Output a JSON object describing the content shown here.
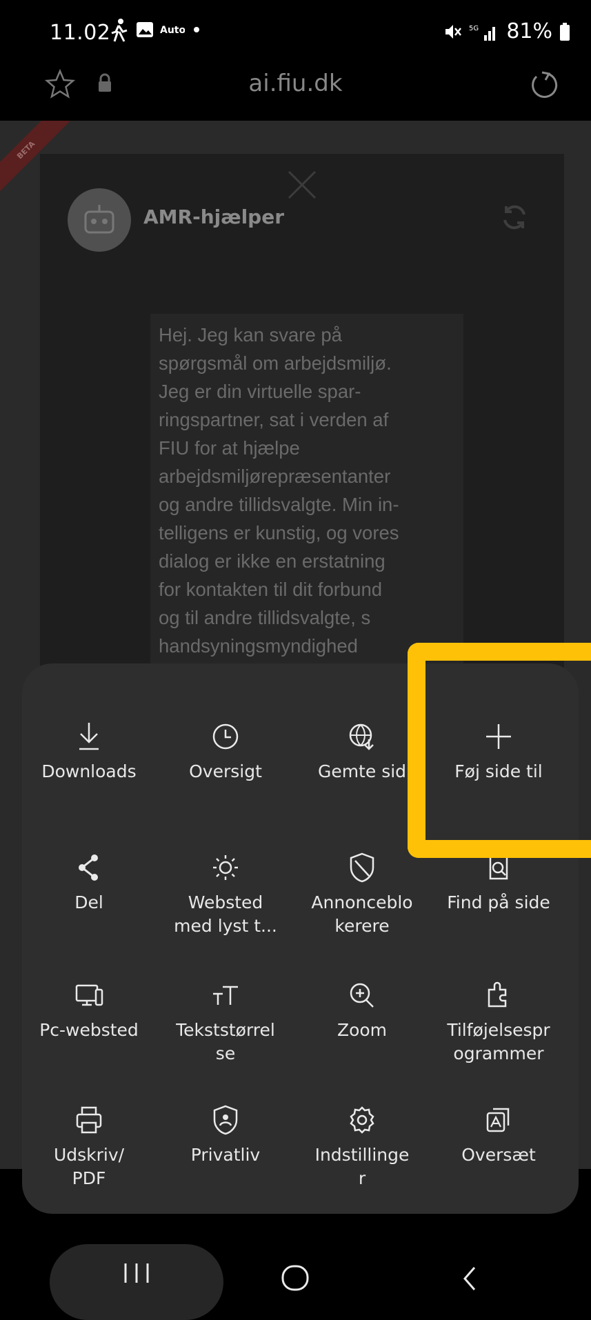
{
  "status_bar": {
    "time": "11.02",
    "battery": "81%",
    "icons": [
      "walk-icon",
      "image-icon",
      "auto-icon",
      "dot-icon",
      "mute-icon",
      "signal-icon",
      "battery-icon"
    ]
  },
  "url_bar": {
    "url": "ai.fiu.dk",
    "icons": [
      "star-icon",
      "lock-icon",
      "reload-icon"
    ]
  },
  "page": {
    "beta": "BETA",
    "bot_name": "AMR-hjælper",
    "message": "Hej. Jeg kan svare på\nspørgsmål om arbejdsmiljø.\nJeg er din virtuelle spar-\nringspartner, sat i verden af\nFIU for at hjælpe\narbejdsmiljørepræsentanter\nog andre tillidsvalgte. Min in-\ntelligens er kunstig, og vores\ndialog er ikke en erstatning\nfor kontakten til dit forbund\nog til andre tillidsvalgte, s\nhandsyningsmyndighed"
  },
  "menu": {
    "items": [
      {
        "label": "Downloads",
        "icon": "download-icon"
      },
      {
        "label": "Oversigt",
        "icon": "clock-icon"
      },
      {
        "label": "Gemte sid",
        "icon": "saved-pages-icon"
      },
      {
        "label": "Føj side til",
        "icon": "plus-icon"
      },
      {
        "label": "Del",
        "icon": "share-icon"
      },
      {
        "label": "Websted\nmed lyst t...",
        "icon": "sun-icon"
      },
      {
        "label": "Annonceblo\nkerere",
        "icon": "ad-block-icon"
      },
      {
        "label": "Find på side",
        "icon": "find-icon"
      },
      {
        "label": "Pc-websted",
        "icon": "desktop-icon"
      },
      {
        "label": "Tekststørrel\nse",
        "icon": "text-size-icon"
      },
      {
        "label": "Zoom",
        "icon": "zoom-icon"
      },
      {
        "label": "Tilføjelsespr\nogrammer",
        "icon": "addons-icon"
      },
      {
        "label": "Udskriv/\nPDF",
        "icon": "print-icon"
      },
      {
        "label": "Privatliv",
        "icon": "privacy-icon"
      },
      {
        "label": "Indstillinge\nr",
        "icon": "settings-icon"
      },
      {
        "label": "Oversæt",
        "icon": "translate-icon"
      }
    ],
    "highlight_color": "#ffc107"
  },
  "nav_bar": {
    "icons": [
      "recent-apps-icon",
      "home-icon",
      "back-icon"
    ]
  }
}
